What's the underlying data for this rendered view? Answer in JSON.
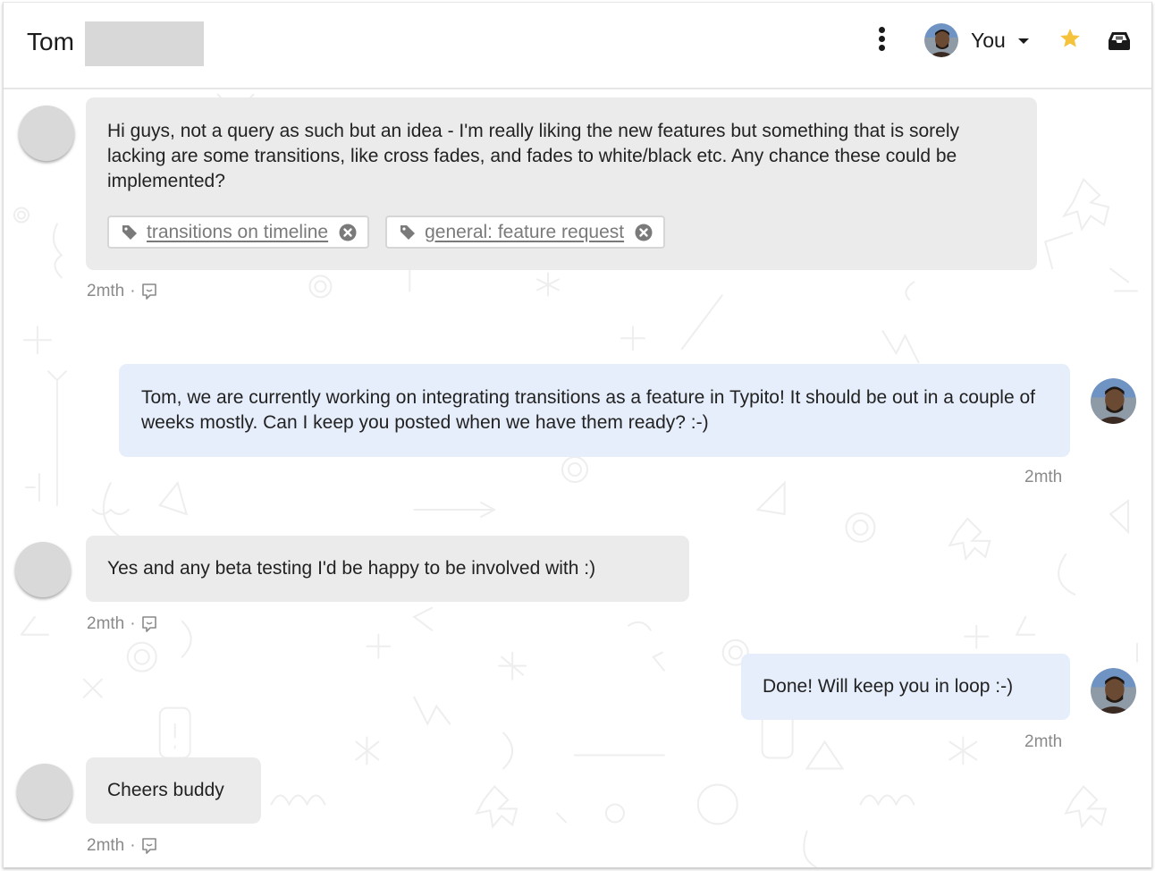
{
  "header": {
    "title": "Tom",
    "more_icon": "kebab-vertical-icon",
    "user_label": "You",
    "star_icon": "star-icon",
    "inbox_icon": "inbox-icon"
  },
  "colors": {
    "accent_star": "#f5c23b",
    "incoming_bubble": "#ebebeb",
    "outgoing_bubble": "#e6eefb",
    "meta_text": "#8a8a8a"
  },
  "messages": [
    {
      "direction": "incoming",
      "text": "Hi guys, not a query as such but an idea - I'm really liking the new features but something that is sorely lacking are some transitions, like cross fades, and fades to white/black etc. Any chance these could be implemented?",
      "tags": [
        {
          "label": "transitions on timeline"
        },
        {
          "label": "general: feature request"
        }
      ],
      "time": "2mth",
      "separator": "·"
    },
    {
      "direction": "outgoing",
      "text": "Tom, we are currently working on integrating transitions as a feature in Typito! It should be out in a couple of weeks mostly. Can I keep you posted when we have them ready? :-)",
      "time": "2mth"
    },
    {
      "direction": "incoming",
      "text": "Yes and any beta testing I'd be happy to be involved with :)",
      "time": "2mth",
      "separator": "·"
    },
    {
      "direction": "outgoing",
      "text": "Done! Will keep you in loop :-)",
      "time": "2mth"
    },
    {
      "direction": "incoming",
      "text": "Cheers buddy",
      "time": "2mth",
      "separator": "·"
    }
  ]
}
